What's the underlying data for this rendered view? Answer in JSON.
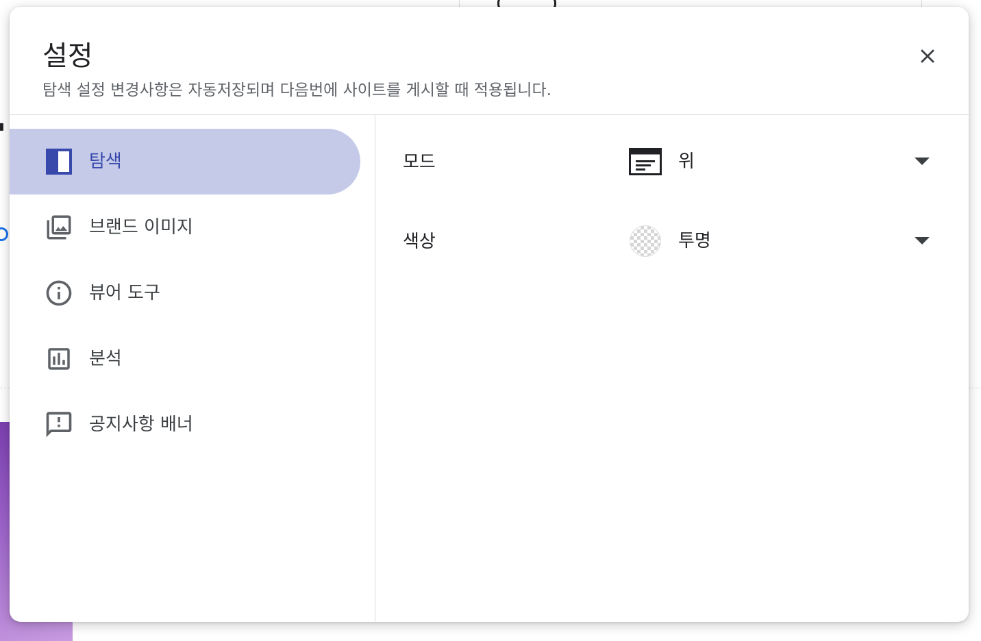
{
  "dialog": {
    "title": "설정",
    "subtitle": "탐색 설정 변경사항은 자동저장되며 다음번에 사이트를 게시할 때 적용됩니다.",
    "close_icon": "close-icon"
  },
  "sidebar": {
    "items": [
      {
        "label": "탐색",
        "icon": "navigation-panel-icon",
        "active": true
      },
      {
        "label": "브랜드 이미지",
        "icon": "photo-library-icon",
        "active": false
      },
      {
        "label": "뷰어 도구",
        "icon": "info-icon",
        "active": false
      },
      {
        "label": "분석",
        "icon": "bar-chart-icon",
        "active": false
      },
      {
        "label": "공지사항 배너",
        "icon": "feedback-icon",
        "active": false
      }
    ]
  },
  "settings": {
    "mode": {
      "label": "모드",
      "value": "위",
      "icon": "top-nav-layout-icon"
    },
    "color": {
      "label": "색상",
      "value": "투명",
      "icon": "transparent-swatch-icon"
    }
  },
  "colors": {
    "accent": "#3949ab",
    "active_bg": "#c5cae9",
    "text": "#202124",
    "secondary_text": "#5f6368",
    "divider": "#dadce0"
  }
}
